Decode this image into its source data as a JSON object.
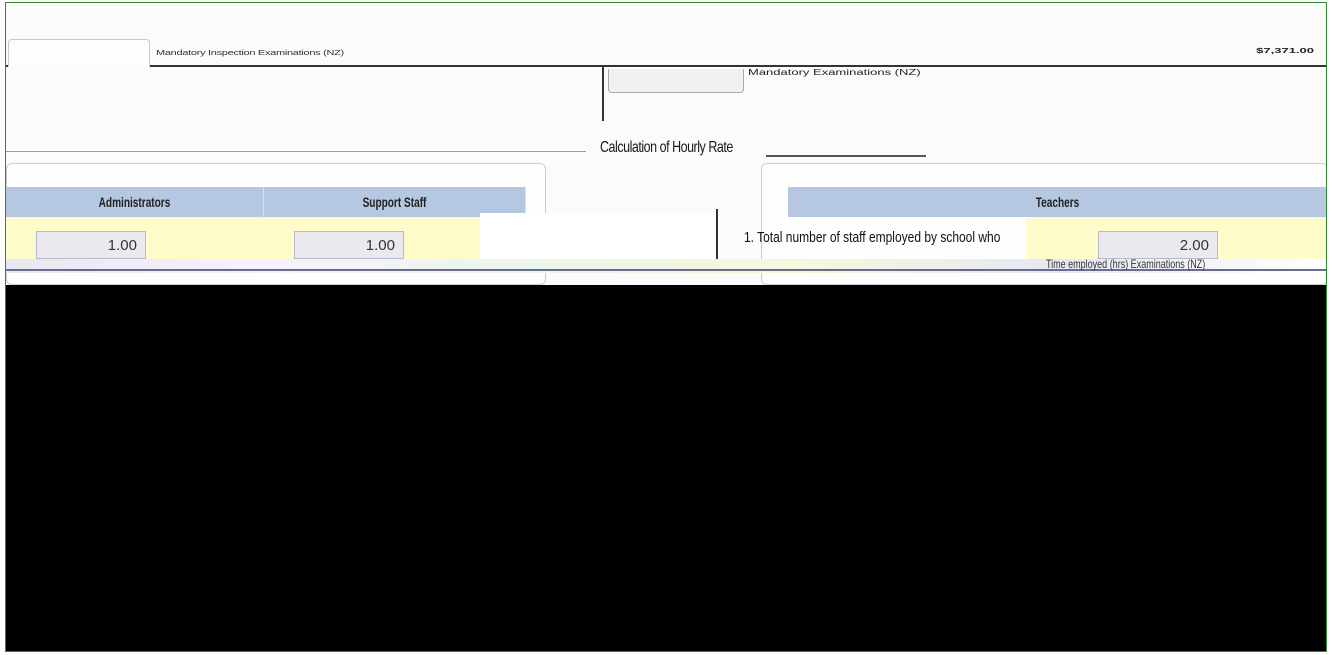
{
  "top": {
    "caption": "Mandatory Inspection Examinations (NZ)",
    "total": "$7,371.00"
  },
  "mid": {
    "select_value": "",
    "caption": "Mandatory Examinations (NZ)"
  },
  "section": {
    "title": "Calculation of Hourly Rate"
  },
  "table": {
    "headers": {
      "administrators": "Administrators",
      "support_staff": "Support Staff",
      "teachers": "Teachers"
    },
    "row1": {
      "question": "1. Total number of staff employed by school who",
      "administrators": "1.00",
      "support_staff": "1.00",
      "teachers": "2.00"
    }
  },
  "footer_strip": {
    "text": "Time employed (hrs) Examinations (NZ)"
  }
}
